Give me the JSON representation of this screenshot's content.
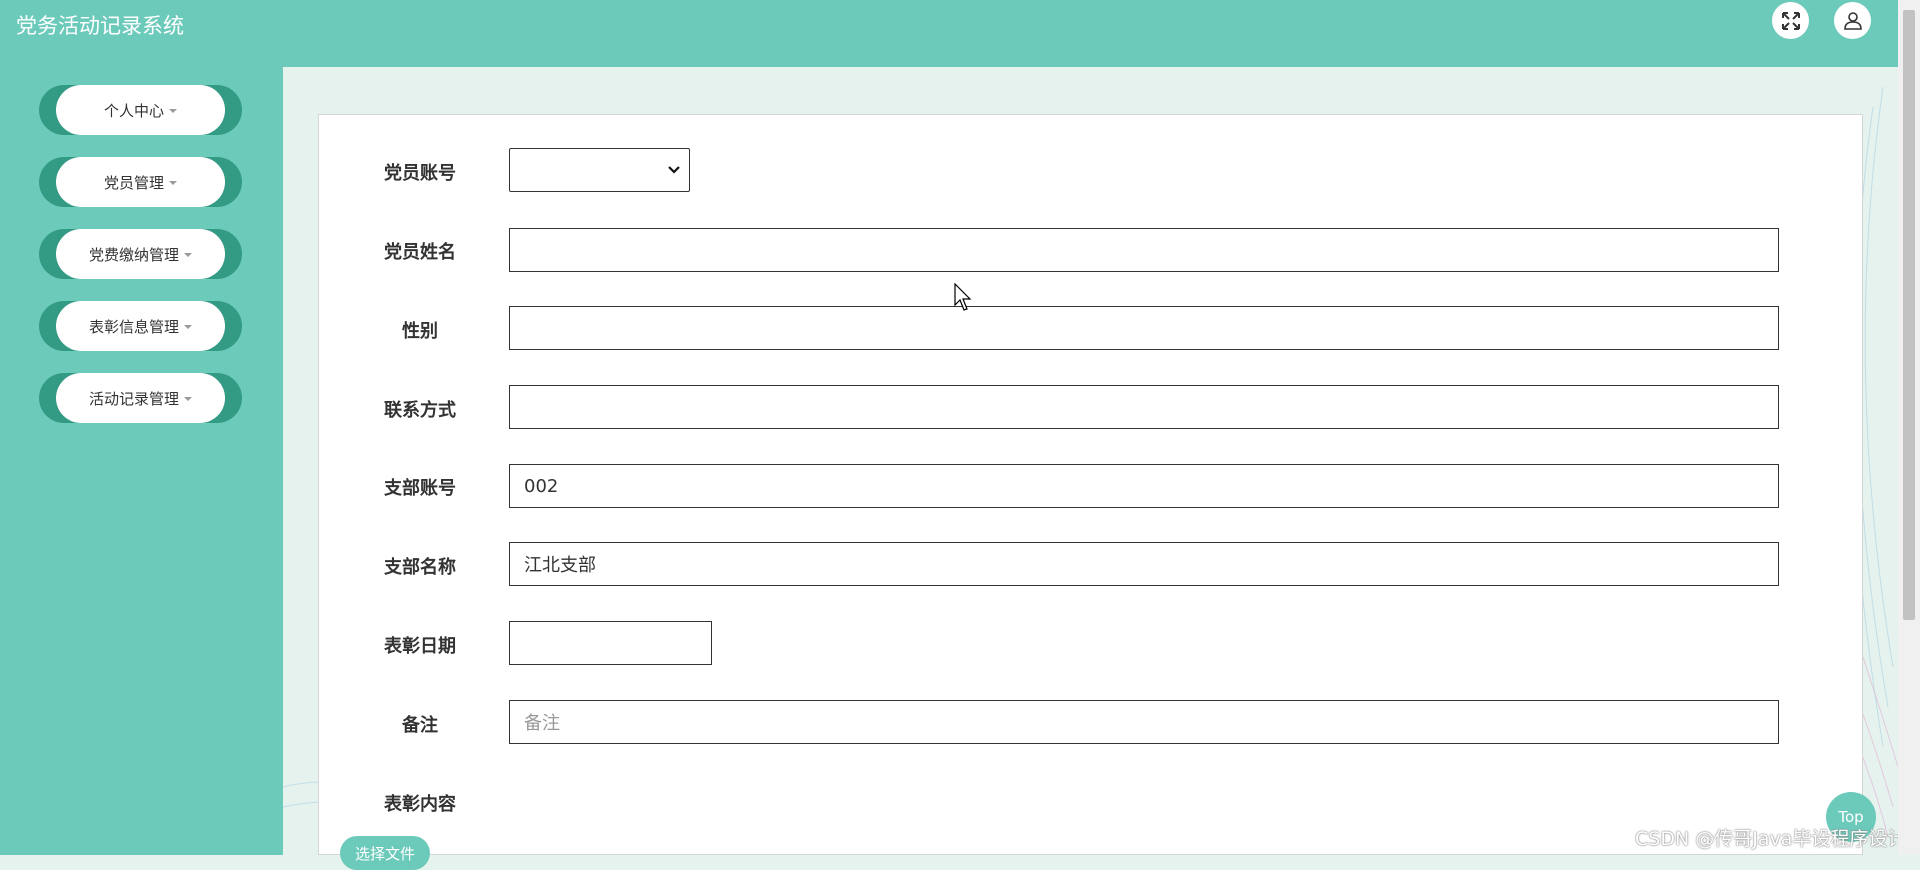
{
  "header": {
    "title": "党务活动记录系统",
    "fullscreen_icon": "fullscreen-icon",
    "user_icon": "user-icon"
  },
  "sidebar": {
    "items": [
      {
        "label": "个人中心"
      },
      {
        "label": "党员管理"
      },
      {
        "label": "党费缴纳管理"
      },
      {
        "label": "表彰信息管理"
      },
      {
        "label": "活动记录管理"
      }
    ]
  },
  "form": {
    "member_account": {
      "label": "党员账号",
      "value": ""
    },
    "member_name": {
      "label": "党员姓名",
      "value": ""
    },
    "gender": {
      "label": "性别",
      "value": ""
    },
    "contact": {
      "label": "联系方式",
      "value": ""
    },
    "branch_account": {
      "label": "支部账号",
      "value": "002"
    },
    "branch_name": {
      "label": "支部名称",
      "value": "江北支部"
    },
    "commend_date": {
      "label": "表彰日期",
      "value": ""
    },
    "remark": {
      "label": "备注",
      "placeholder": "备注"
    },
    "commend_content": {
      "label": "表彰内容"
    },
    "upload_label": "选择文件"
  },
  "top_button": "Top",
  "watermark": "CSDN @传哥Java毕设程序设计",
  "colors": {
    "primary": "#6ccabb",
    "pill_dark": "#339b84",
    "background": "#e6f2ed"
  }
}
